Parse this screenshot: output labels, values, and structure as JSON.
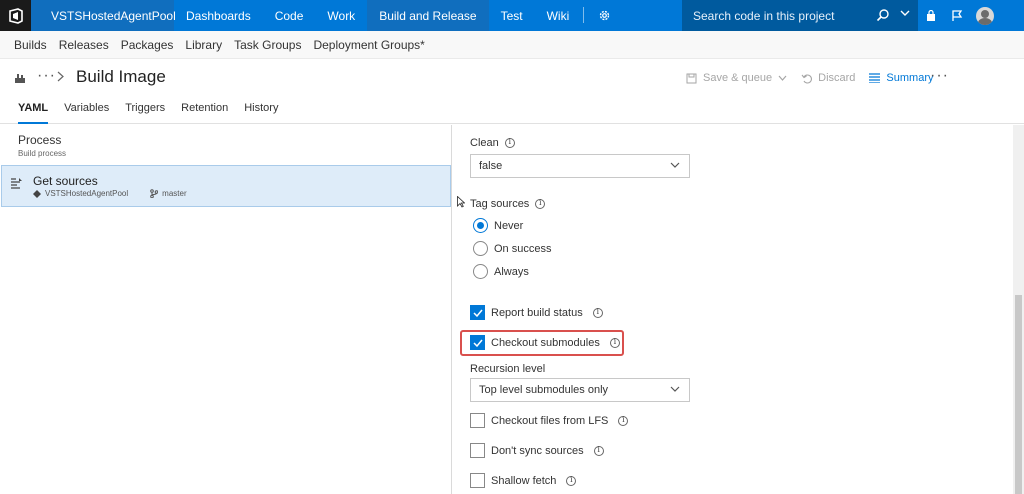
{
  "topbar": {
    "project": "VSTSHostedAgentPool",
    "nav": [
      "Dashboards",
      "Code",
      "Work",
      "Build and Release",
      "Test",
      "Wiki"
    ],
    "active_nav": "Build and Release",
    "search_placeholder": "Search code in this project",
    "brand_color": "#0078d7"
  },
  "subnav": [
    "Builds",
    "Releases",
    "Packages",
    "Library",
    "Task Groups",
    "Deployment Groups*"
  ],
  "header": {
    "title": "Build Image",
    "save_queue": "Save & queue",
    "discard": "Discard",
    "summary": "Summary"
  },
  "tabs": [
    "YAML",
    "Variables",
    "Triggers",
    "Retention",
    "History"
  ],
  "active_tab": "YAML",
  "left": {
    "process_title": "Process",
    "process_sub": "Build process",
    "get_sources": "Get sources",
    "pool": "VSTSHostedAgentPool",
    "branch": "master"
  },
  "right": {
    "clean_label": "Clean",
    "clean_value": "false",
    "tag_label": "Tag sources",
    "tag_options": [
      "Never",
      "On success",
      "Always"
    ],
    "tag_selected": "Never",
    "report_build_status": "Report build status",
    "checkout_submodules": "Checkout submodules",
    "recursion_label": "Recursion level",
    "recursion_value": "Top level submodules only",
    "checkout_lfs": "Checkout files from LFS",
    "dont_sync": "Don't sync sources",
    "shallow_fetch": "Shallow fetch",
    "report_checked": true,
    "submodules_checked": true,
    "lfs_checked": false,
    "dont_sync_checked": false,
    "shallow_checked": false
  }
}
